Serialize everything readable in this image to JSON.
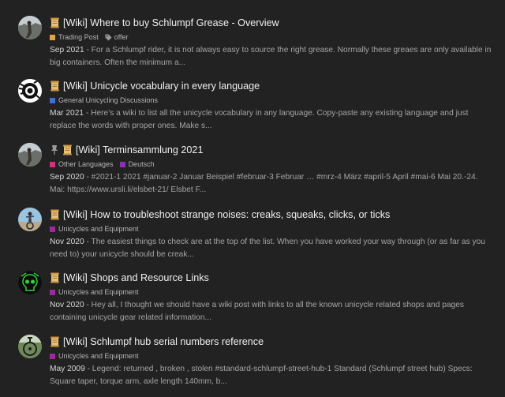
{
  "colors": {
    "background": "#222222",
    "trading_post": "#e6a23c",
    "general_unicycling": "#3f6fd1",
    "other_languages": "#d6307a",
    "deutsch": "#8a2fb8",
    "unicycles_and_equipment": "#9b2a9b"
  },
  "topics": [
    {
      "avatar": "avatar-photo",
      "title": "[Wiki] Where to buy Schlumpf Grease - Overview",
      "categories": [
        {
          "label": "Trading Post",
          "color": "#e6a23c"
        }
      ],
      "tag": "offer",
      "date": "Sep 2021",
      "excerpt": " - For a Schlumpf rider, it is not always easy to source the right grease. Normally these greaes are only available in big containers. Often the minimum a..."
    },
    {
      "avatar": "avatar-logo",
      "title": "[Wiki] Unicycle vocabulary in every language",
      "categories": [
        {
          "label": "General Unicycling Discussions",
          "color": "#3f6fd1"
        }
      ],
      "date": "Mar 2021",
      "excerpt": " - Here’s a wiki to list all the unicycle vocabulary in any language. Copy-paste any existing language and just replace the words with proper ones. Make s..."
    },
    {
      "avatar": "avatar-photo",
      "pinned": true,
      "title": "[Wiki] Terminsammlung 2021",
      "categories": [
        {
          "label": "Other Languages",
          "color": "#d6307a"
        },
        {
          "label": "Deutsch",
          "color": "#8a2fb8"
        }
      ],
      "date": "Sep 2020",
      "excerpt": " - #2021-1 2021 #januar-2 Januar Beispiel #februar-3 Februar … #mrz-4 März #april-5 April #mai-6 Mai 20.-24. Mai: https://www.ursli.li/elsbet-21/ Elsbet F..."
    },
    {
      "avatar": "avatar-rider",
      "title": "[Wiki] How to troubleshoot strange noises: creaks, squeaks, clicks, or ticks",
      "categories": [
        {
          "label": "Unicycles and Equipment",
          "color": "#9b2a9b"
        }
      ],
      "date": "Nov 2020",
      "excerpt": " - The easiest things to check are at the top of the list. When you have worked your way through (or as far as you need to) your unicycle should be creak..."
    },
    {
      "avatar": "avatar-skull",
      "title": "[Wiki] Shops and Resource Links",
      "categories": [
        {
          "label": "Unicycles and Equipment",
          "color": "#9b2a9b"
        }
      ],
      "date": "Nov 2020",
      "excerpt": " - Hey all, I thought we should have a wiki post with links to all the known unicycle related shops and pages containing unicycle gear related information..."
    },
    {
      "avatar": "avatar-bike",
      "title": "[Wiki] Schlumpf hub serial numbers reference",
      "categories": [
        {
          "label": "Unicycles and Equipment",
          "color": "#9b2a9b"
        }
      ],
      "date": "May 2009",
      "excerpt": " - Legend: returned , broken , stolen #standard-schlumpf-street-hub-1 Standard (Schlumpf street hub) Specs: Square taper, torque arm, axle length 140mm, b..."
    }
  ]
}
